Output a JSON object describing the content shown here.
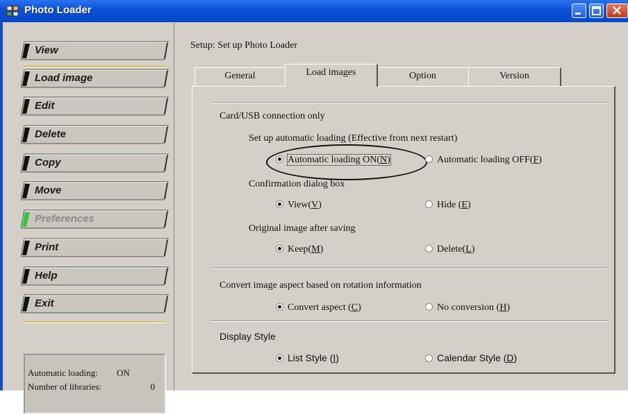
{
  "window": {
    "title": "Photo Loader"
  },
  "sidebar": {
    "items": [
      {
        "label": "View",
        "disabled": false
      },
      {
        "label": "Load image",
        "disabled": false
      },
      {
        "label": "Edit",
        "disabled": false
      },
      {
        "label": "Delete",
        "disabled": false
      },
      {
        "label": "Copy",
        "disabled": false
      },
      {
        "label": "Move",
        "disabled": false
      },
      {
        "label": "Preferences",
        "disabled": true
      },
      {
        "label": "Print",
        "disabled": false
      },
      {
        "label": "Help",
        "disabled": false
      },
      {
        "label": "Exit",
        "disabled": false
      }
    ],
    "status": {
      "auto_loading_label": "Automatic loading:",
      "auto_loading_value": "ON",
      "libraries_label": "Number of libraries:",
      "libraries_value": "0"
    }
  },
  "main": {
    "setup_label": "Setup: Set up Photo Loader",
    "tabs": [
      {
        "label": "General",
        "active": false
      },
      {
        "label": "Load images",
        "active": true
      },
      {
        "label": "Option",
        "active": false
      },
      {
        "label": "Version",
        "active": false
      }
    ],
    "card_section": "Card/USB connection only",
    "auto_loading": {
      "heading": "Set up automatic loading (Effective from next restart)",
      "on": {
        "label": "Automatic loading ON(",
        "key": "N",
        "end": ")",
        "checked": true
      },
      "off": {
        "label": "Automatic loading OFF(",
        "key": "F",
        "end": ")",
        "checked": false
      }
    },
    "confirmation": {
      "heading": "Confirmation dialog box",
      "view": {
        "label": "View(",
        "key": "V",
        "end": ")",
        "checked": true
      },
      "hide": {
        "label": "Hide (",
        "key": "E",
        "end": ")",
        "checked": false
      }
    },
    "original": {
      "heading": "Original image after saving",
      "keep": {
        "label": "Keep(",
        "key": "M",
        "end": ")",
        "checked": true
      },
      "delete": {
        "label": "Delete(",
        "key": "L",
        "end": ")",
        "checked": false
      }
    },
    "aspect": {
      "heading": "Convert image aspect based on rotation information",
      "convert": {
        "label": "Convert aspect (",
        "key": "C",
        "end": ")",
        "checked": true
      },
      "none": {
        "label": "No conversion (",
        "key": "H",
        "end": ")",
        "checked": false
      }
    },
    "display": {
      "heading": "Display Style",
      "list": {
        "label": "List Style (",
        "key": "I",
        "end": ")",
        "checked": true
      },
      "calendar": {
        "label": "Calendar Style (",
        "key": "D",
        "end": ")",
        "checked": false
      }
    }
  },
  "colors": {
    "title_bar": "#0a4fd8",
    "face": "#d4d0c8",
    "preferences_accent": "#30c830",
    "nav_accent": "#111111"
  },
  "icons": {
    "app": "photo-loader-app-icon",
    "minimize": "minimize-icon",
    "maximize": "maximize-icon",
    "close": "close-icon"
  }
}
